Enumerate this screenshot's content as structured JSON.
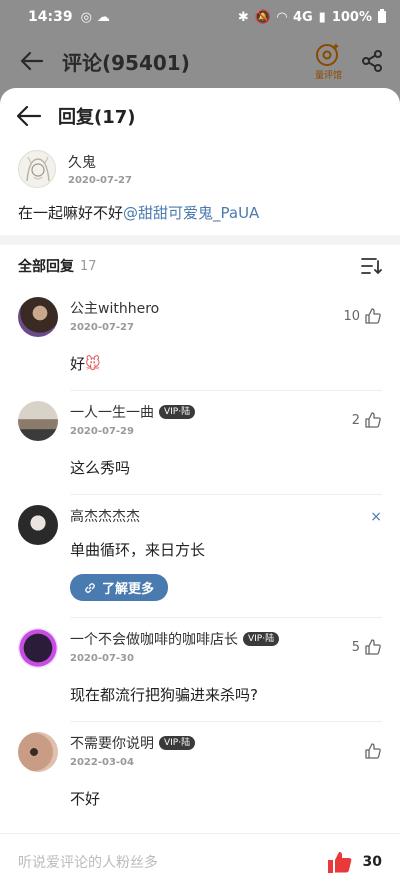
{
  "status_bar": {
    "time": "14:39",
    "battery": "100%",
    "network": "4G"
  },
  "top_bar": {
    "title": "评论(95401)",
    "quanpingguan_label": "量评馆"
  },
  "sheet": {
    "title": "回复(17)",
    "root_comment": {
      "nickname": "久鬼",
      "date": "2020-07-27",
      "text": "在一起嘛好不好",
      "mention": "@甜甜可爱鬼_PaUA"
    },
    "all_replies": {
      "label": "全部回复",
      "count": "17"
    },
    "replies": [
      {
        "nickname": "公主withhero",
        "date": "2020-07-27",
        "text": "好",
        "likes": "10",
        "vip": ""
      },
      {
        "nickname": "一人一生一曲",
        "date": "2020-07-29",
        "text": "这么秀吗",
        "likes": "2",
        "vip": "VIP·陆"
      },
      {
        "nickname": "一个不会做咖啡的咖啡店长",
        "date": "2020-07-30",
        "text": "现在都流行把狗骗进来杀吗?",
        "likes": "5",
        "vip": "VIP·陆"
      },
      {
        "nickname": "不需要你说明",
        "date": "2022-03-04",
        "text": "不好",
        "likes": "",
        "vip": "VIP·陆"
      }
    ],
    "ad": {
      "nickname": "高杰杰杰杰",
      "text": "单曲循环，来日方长",
      "button_label": "了解更多",
      "close": "×"
    }
  },
  "bottom_bar": {
    "placeholder": "听说爱评论的人粉丝多",
    "likes": "30"
  },
  "colors": {
    "link": "#4a7bb0",
    "like_red": "#e83a3a"
  }
}
